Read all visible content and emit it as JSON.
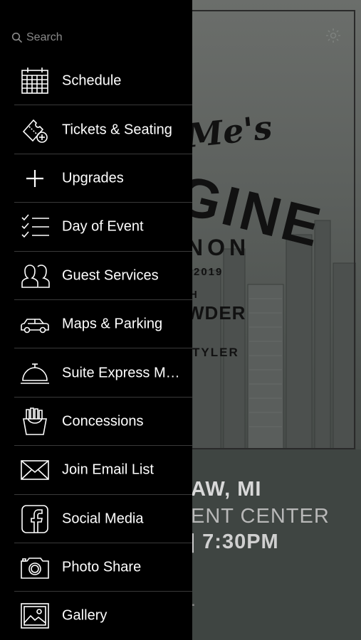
{
  "search": {
    "placeholder": "Search",
    "icon": "search-icon"
  },
  "menu": [
    {
      "label": "Schedule",
      "icon": "calendar-icon"
    },
    {
      "label": "Tickets & Seating",
      "icon": "ticket-icon"
    },
    {
      "label": "Upgrades",
      "icon": "plus-icon"
    },
    {
      "label": "Day of Event",
      "icon": "checklist-icon"
    },
    {
      "label": "Guest Services",
      "icon": "people-icon"
    },
    {
      "label": "Maps & Parking",
      "icon": "car-icon"
    },
    {
      "label": "Suite Express M…",
      "icon": "service-bell-icon"
    },
    {
      "label": "Concessions",
      "icon": "fries-icon"
    },
    {
      "label": "Join Email List",
      "icon": "envelope-icon"
    },
    {
      "label": "Social Media",
      "icon": "facebook-icon"
    },
    {
      "label": "Photo Share",
      "icon": "camera-icon"
    },
    {
      "label": "Gallery",
      "icon": "image-icon"
    }
  ],
  "poster": {
    "script_text": "Me's",
    "big_text": "GINE",
    "sub_text": "NON",
    "date_text": "2019",
    "h_text": "H",
    "vder_text": "WDER",
    "tyler_text": "TYLER",
    "city_text": "AW, MI",
    "venue_text": "ENT CENTER",
    "time_text": "| 7:30PM",
    "misc_text": "L"
  },
  "colors": {
    "drawer_bg": "#000000",
    "divider": "#3a3a3a",
    "label": "#ffffff",
    "search_text": "#8a8a8a"
  }
}
